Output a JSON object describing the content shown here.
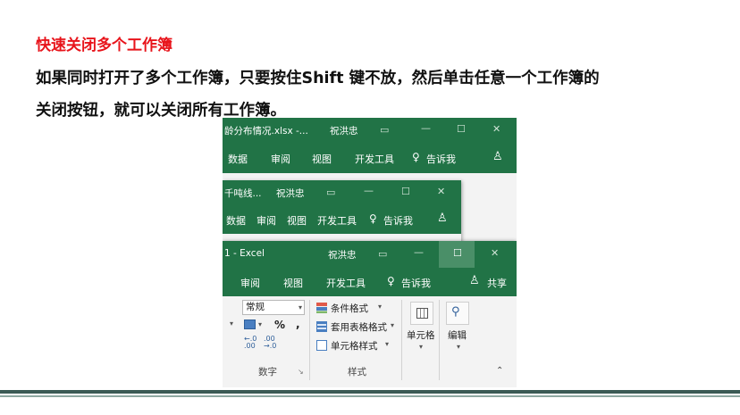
{
  "slide": {
    "title": "快速关闭多个工作簿",
    "body_line1": "如果同时打开了多个工作簿，只要按住Shift 键不放，然后单击任意一个工作簿的",
    "body_line2": "关闭按钮，就可以关闭所有工作簿。"
  },
  "window1": {
    "title": "龄分布情况.xlsx -...",
    "user": "祝洪忠",
    "tabs": [
      "数据",
      "审阅",
      "视图",
      "开发工具"
    ],
    "tell_me": "告诉我"
  },
  "window2": {
    "title": "千吨线...",
    "user": "祝洪忠",
    "tabs": [
      "数据",
      "审阅",
      "视图",
      "开发工具"
    ],
    "tell_me": "告诉我"
  },
  "window3": {
    "title": "1 - Excel",
    "user": "祝洪忠",
    "tabs": [
      "审阅",
      "视图",
      "开发工具"
    ],
    "tell_me": "告诉我",
    "share": "共享",
    "ribbon": {
      "number_format": "常规",
      "percent": "%",
      "comma": ",",
      "group_number": "数字",
      "conditional_format": "条件格式",
      "format_as_table": "套用表格格式",
      "cell_styles": "单元格样式",
      "group_styles": "样式",
      "cells": "单元格",
      "editing": "编辑"
    }
  },
  "colors": {
    "excel_green": "#217346",
    "title_red": "#e8141b",
    "footer_line": "#3b5a55"
  }
}
